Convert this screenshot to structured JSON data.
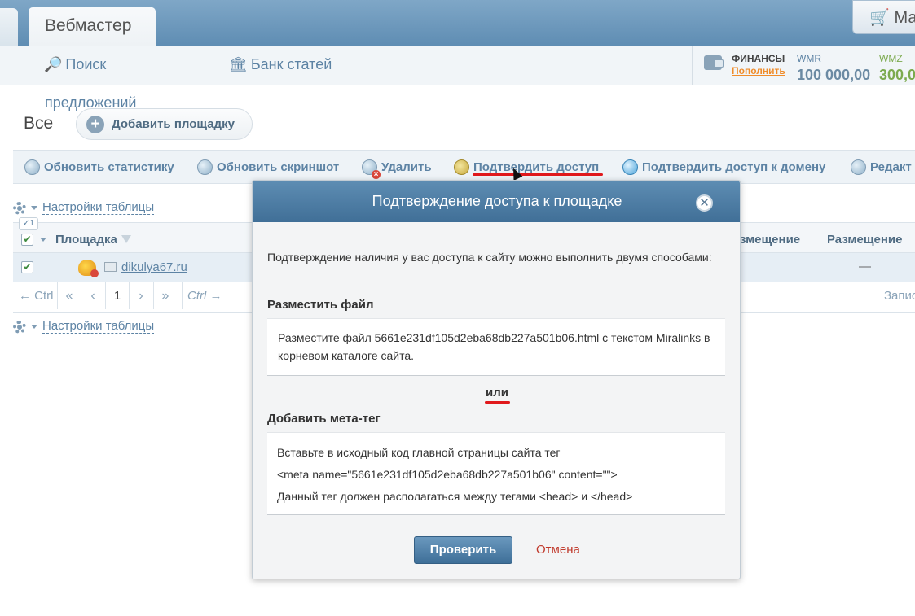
{
  "header": {
    "active_tab": "Вебмастер",
    "cart_label": "Маг"
  },
  "nav": {
    "search": "Поиск",
    "bank": "Банк статей",
    "proposals": "предложений"
  },
  "finance": {
    "title": "ФИНАНСЫ",
    "fill": "Пополнить",
    "wmr_label": "WMR",
    "wmr_value": "100 000,00",
    "wmz_label": "WMZ",
    "wmz_value": "300,0"
  },
  "filters": {
    "all": "Все",
    "add_site": "Добавить площадку"
  },
  "toolbar": {
    "refresh_stats": "Обновить статистику",
    "refresh_screenshot": "Обновить скриншот",
    "delete": "Удалить",
    "confirm_access": "Подтвердить доступ",
    "confirm_domain": "Подтвердить доступ к домену",
    "edit": "Редакт"
  },
  "table": {
    "settings": "Настройки таблицы",
    "selected_count": "1",
    "col_site": "Площадка",
    "col_right1": "змещение",
    "col_right2": "Размещение",
    "rows": [
      {
        "site": "dikulya67.ru",
        "placement": "—"
      }
    ],
    "pager": {
      "prev": "← Ctrl",
      "first": "«",
      "back": "‹",
      "page": "1",
      "forward": "›",
      "last": "»",
      "next": "Ctrl →",
      "records": "Запис"
    }
  },
  "modal": {
    "title": "Подтверждение доступа к площадке",
    "intro": "Подтверждение наличия у вас доступа к сайту можно выполнить двумя способами:",
    "file_heading": "Разместить файл",
    "file_text": "Разместите файл 5661e231df105d2eba68db227a501b06.html с текстом Miralinks в корневом каталоге сайта.",
    "or": "или",
    "meta_heading": "Добавить мета-тег",
    "meta_line1": "Вставьте в исходный код главной страницы сайта тег",
    "meta_line2": "<meta name=\"5661e231df105d2eba68db227a501b06\" content=\"\">",
    "meta_line3": "Данный тег должен располагаться между тегами <head> и </head>",
    "verify": "Проверить",
    "cancel": "Отмена"
  },
  "colors": {
    "primary": "#406f97",
    "link": "#5d83a4",
    "wmz": "#7caa4e",
    "accent_orange": "#f08c2a",
    "annotation_red": "#e0191c"
  }
}
